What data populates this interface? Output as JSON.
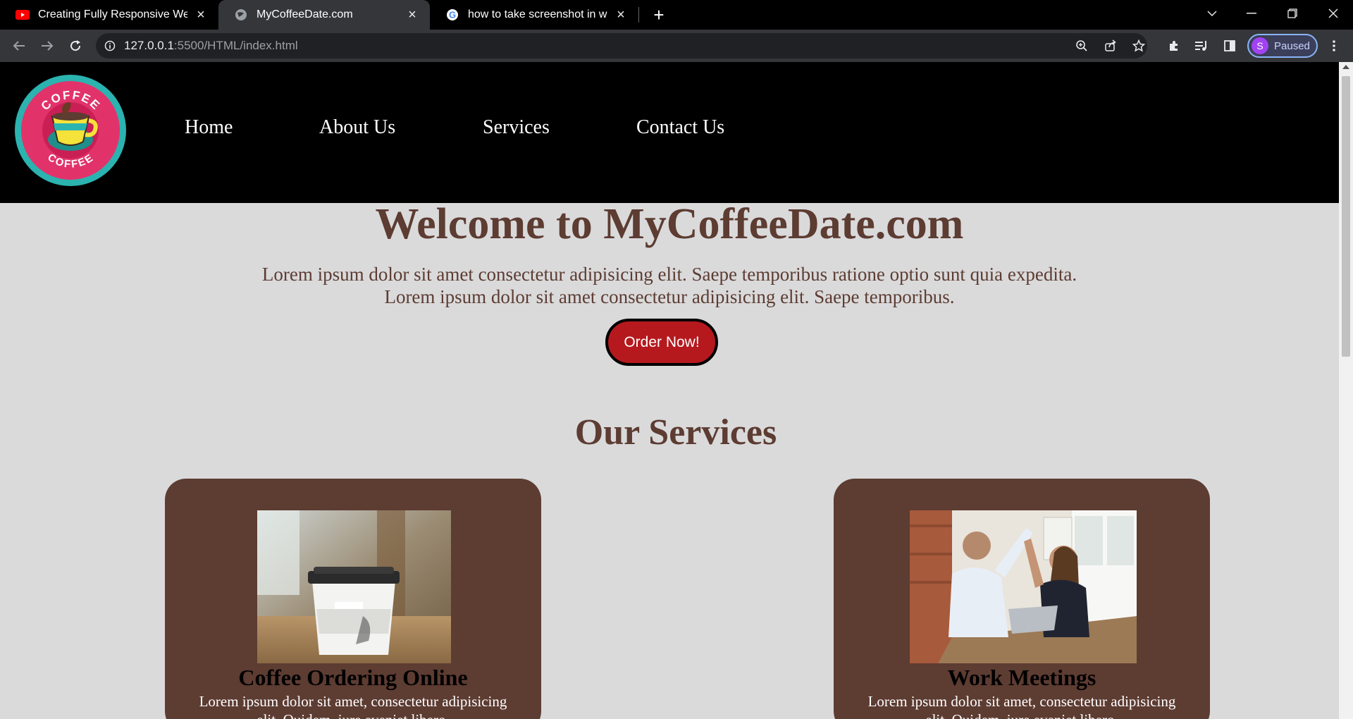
{
  "browser": {
    "tabs": [
      {
        "title": "Creating Fully Responsive Websit",
        "icon": "youtube-icon",
        "active": false
      },
      {
        "title": "MyCoffeeDate.com",
        "icon": "globe-icon",
        "active": true
      },
      {
        "title": "how to take screenshot in windo",
        "icon": "google-icon",
        "active": false
      }
    ],
    "url_host": "127.0.0.1",
    "url_path": ":5500/HTML/index.html",
    "profile_initial": "S",
    "profile_status": "Paused"
  },
  "site": {
    "nav": [
      "Home",
      "About Us",
      "Services",
      "Contact Us"
    ],
    "logo_text": "COFFEE",
    "hero_title": "Welcome to MyCoffeeDate.com",
    "hero_line1": "Lorem ipsum dolor sit amet consectetur adipisicing elit. Saepe temporibus ratione optio sunt quia expedita.",
    "hero_line2": "Lorem ipsum dolor sit amet consectetur adipisicing elit. Saepe temporibus.",
    "order_button": "Order Now!",
    "services_title": "Our Services",
    "cards": [
      {
        "title": "Coffee Ordering Online",
        "text": "Lorem ipsum dolor sit amet, consectetur adipisicing elit. Quidem, iure eveniet libero."
      },
      {
        "title": "Work Meetings",
        "text": "Lorem ipsum dolor sit amet, consectetur adipisicing elit. Quidem, iure eveniet libero."
      }
    ]
  },
  "colors": {
    "brand_brown": "#5d3c32",
    "order_red": "#b5191e",
    "page_bg": "#dadadb",
    "header_bg": "#000000"
  }
}
